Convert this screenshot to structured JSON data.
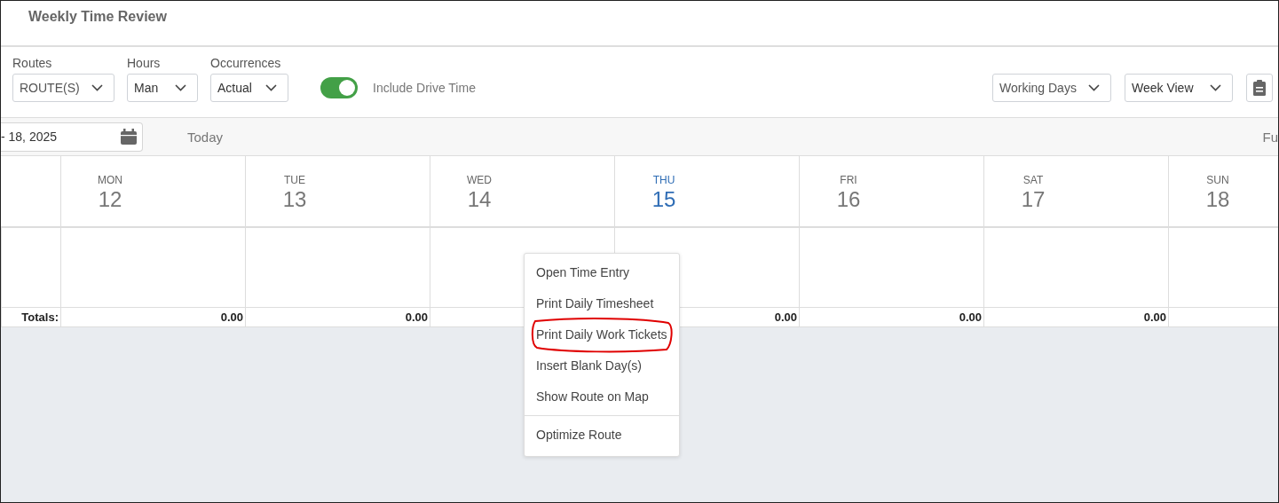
{
  "window": {
    "title": "Weekly Time Review"
  },
  "filters": [
    {
      "label": "Routes",
      "value": "ROUTE(S)"
    },
    {
      "label": "Hours",
      "value": "Man"
    },
    {
      "label": "Occurrences",
      "value": "Actual"
    }
  ],
  "drive_time_toggle": {
    "label": "Include Drive Time",
    "on": true
  },
  "view_selects": [
    {
      "value": "Working Days"
    },
    {
      "value": "Week View"
    }
  ],
  "date_bar": {
    "date": "- 18, 2025",
    "today": "Today",
    "right_text": "Fu"
  },
  "calendar": {
    "totals_label": "Totals:",
    "days": [
      {
        "name": "MON",
        "number": "12",
        "selected": false,
        "total": "0.00"
      },
      {
        "name": "TUE",
        "number": "13",
        "selected": false,
        "total": "0.00"
      },
      {
        "name": "WED",
        "number": "14",
        "selected": false
      },
      {
        "name": "THU",
        "number": "15",
        "selected": true,
        "total": "0.00"
      },
      {
        "name": "FRI",
        "number": "16",
        "selected": false,
        "total": "0.00"
      },
      {
        "name": "SAT",
        "number": "17",
        "selected": false,
        "total": "0.00"
      },
      {
        "name": "SUN",
        "number": "18",
        "selected": false
      }
    ]
  },
  "context_menu": {
    "items": [
      {
        "kind": "item",
        "label": "Open Time Entry",
        "circled": false
      },
      {
        "kind": "item",
        "label": "Print Daily Timesheet",
        "circled": false
      },
      {
        "kind": "item",
        "label": "Print Daily Work Tickets",
        "circled": true
      },
      {
        "kind": "item",
        "label": "Insert Blank Day(s)",
        "circled": false
      },
      {
        "kind": "item",
        "label": "Show Route on Map",
        "circled": false
      },
      {
        "kind": "separator"
      },
      {
        "kind": "item",
        "label": "Optimize Route",
        "circled": false
      }
    ]
  }
}
